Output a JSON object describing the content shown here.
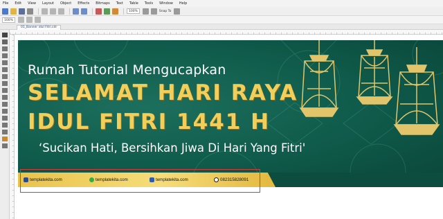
{
  "menu": {
    "items": [
      "File",
      "Edit",
      "View",
      "Layout",
      "Object",
      "Effects",
      "Bitmaps",
      "Text",
      "Table",
      "Tools",
      "Window",
      "Help"
    ]
  },
  "toolbar": {
    "zoom_value": "100%",
    "snap_label": "Snap To"
  },
  "propbar": {
    "zoom_value": "100%"
  },
  "document": {
    "tab_label": "01_Banner idul Fitri.cdr"
  },
  "banner": {
    "line1": "Rumah Tutorial Mengucapkan",
    "line2": "SELAMAT HARI RAYA",
    "line3": "IDUL FITRI 1441 H",
    "line4": "‘Sucikan Hati, Bersihkan Jiwa Di Hari Yang Fitri'"
  },
  "contacts": [
    {
      "icon": "instagram-icon",
      "text": "templatekita.com",
      "color": "#2d4a8a"
    },
    {
      "icon": "whatsapp-icon",
      "text": "templatekita.com",
      "color": "#2fae44"
    },
    {
      "icon": "facebook-icon",
      "text": "templatekita.com",
      "color": "#2f5ea8"
    },
    {
      "icon": "phone-icon",
      "text": "082315828091",
      "color": "#1a1a1a"
    }
  ],
  "colors": {
    "banner_green": "#0f5a4a",
    "gold_text": "#f2cf5b",
    "strip_gold": "#f6dd7a",
    "selection_red": "#d33a3a"
  }
}
